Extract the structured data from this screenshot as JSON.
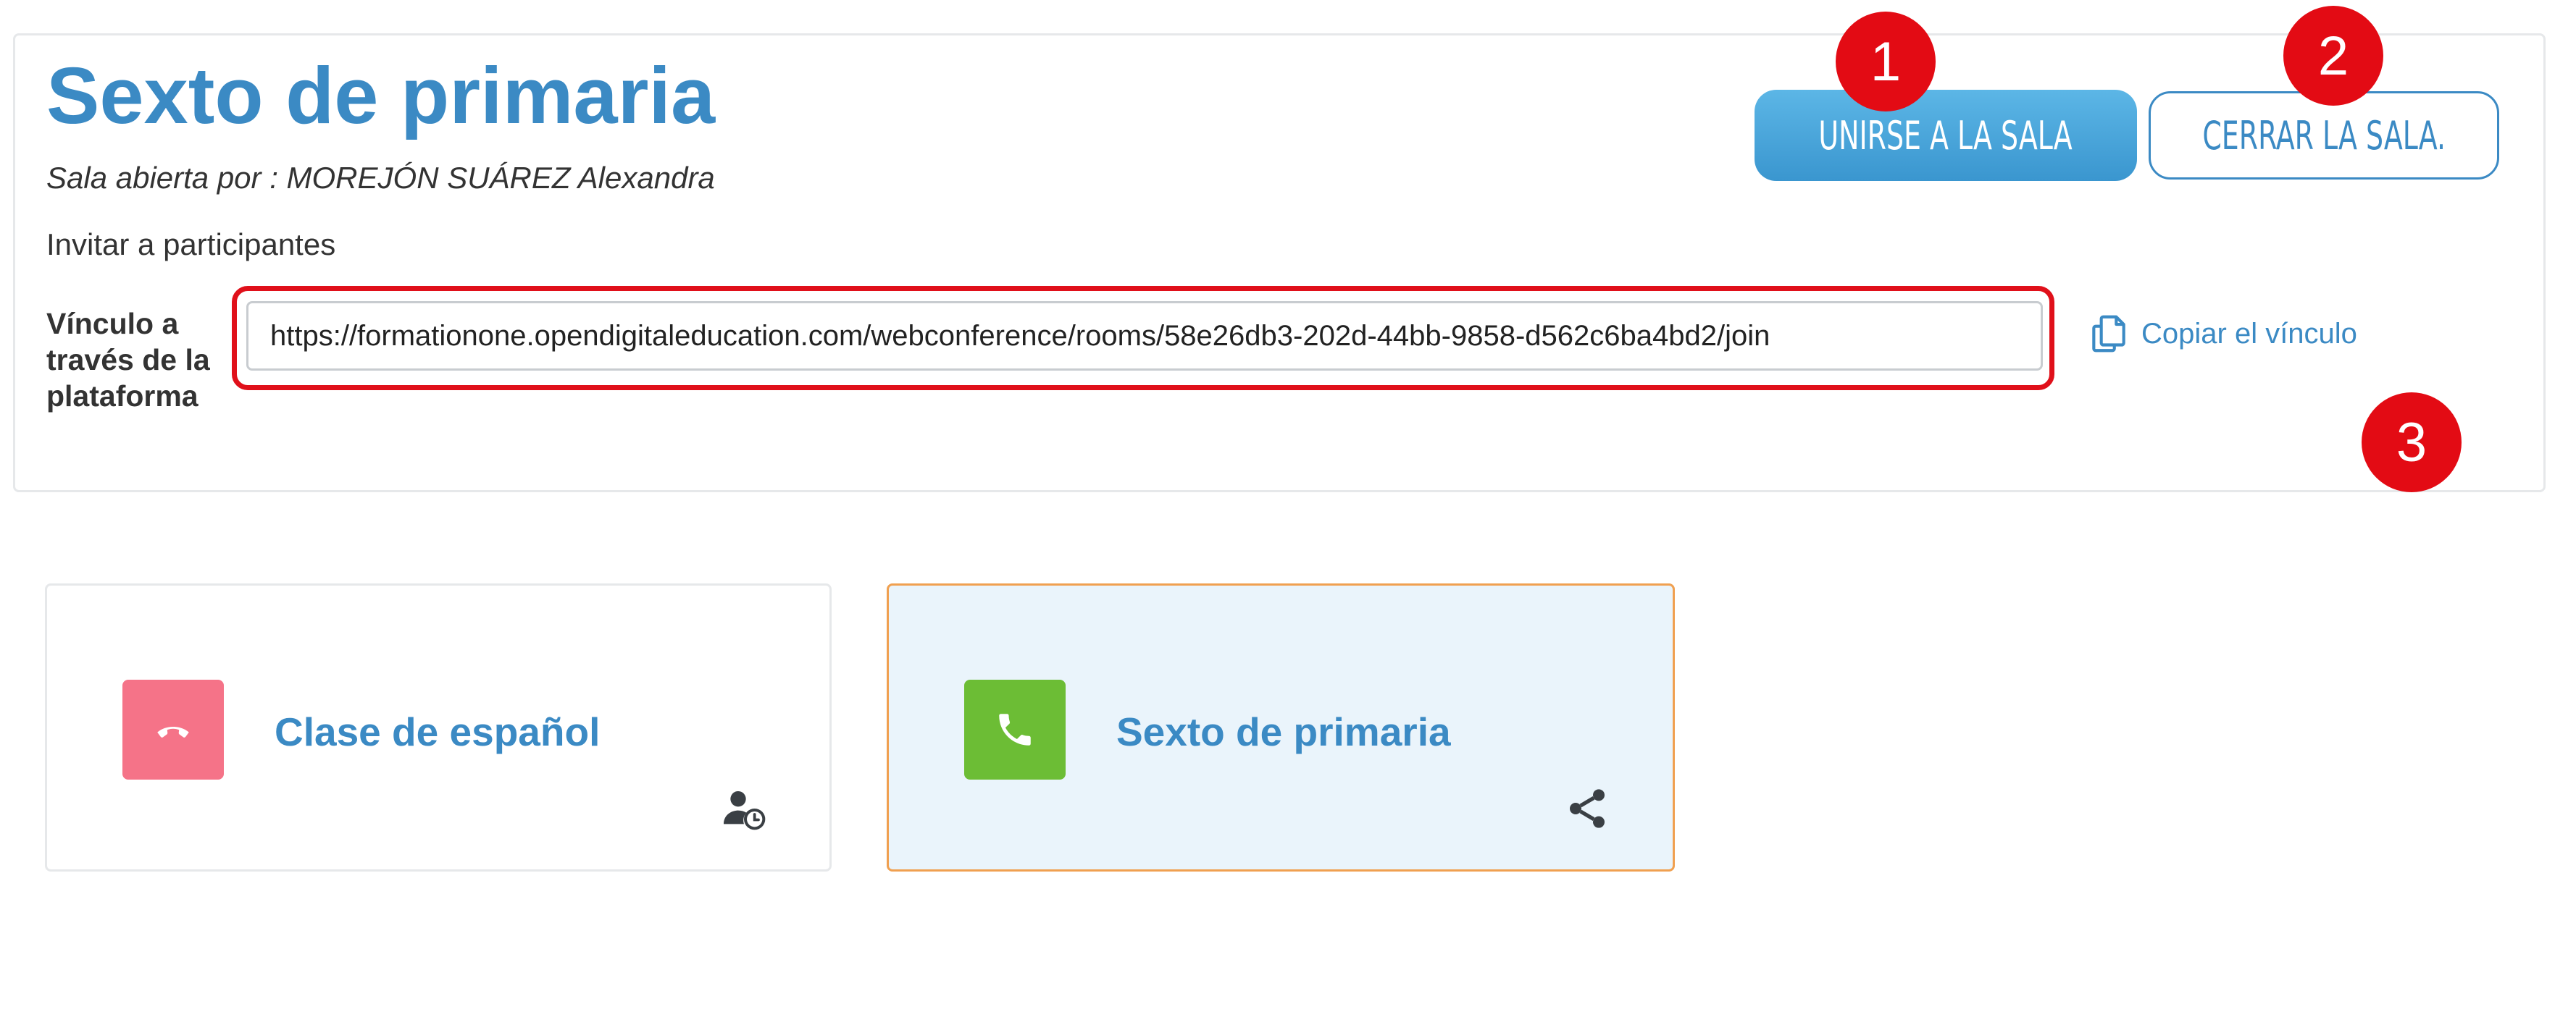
{
  "room": {
    "title": "Sexto de primaria",
    "opened_by": "Sala abierta por : MOREJÓN SUÁREZ Alexandra",
    "invite_label": "Invitar a participantes",
    "link_label": "Vínculo a través de la plataforma",
    "link_value": "https://formationone.opendigitaleducation.com/webconference/rooms/58e26db3-202d-44bb-9858-d562c6ba4bd2/join",
    "copy_link_label": "Copiar el vínculo"
  },
  "actions": {
    "join_label": "UNIRSE A LA SALA",
    "close_label": "CERRAR LA SALA."
  },
  "badges": [
    "1",
    "2",
    "3"
  ],
  "cards": [
    {
      "title": "Clase de español",
      "status_icon": "phone-hangup-icon",
      "status_color": "#f57388",
      "action_icon": "user-clock-icon"
    },
    {
      "title": "Sexto de primaria",
      "status_icon": "phone-icon",
      "status_color": "#6cbd35",
      "action_icon": "share-icon",
      "selected": true
    }
  ],
  "colors": {
    "accent": "#3b8ac4",
    "highlight": "#e30b14",
    "selected_border": "#f0a050",
    "selected_bg": "#eaf4fb"
  }
}
